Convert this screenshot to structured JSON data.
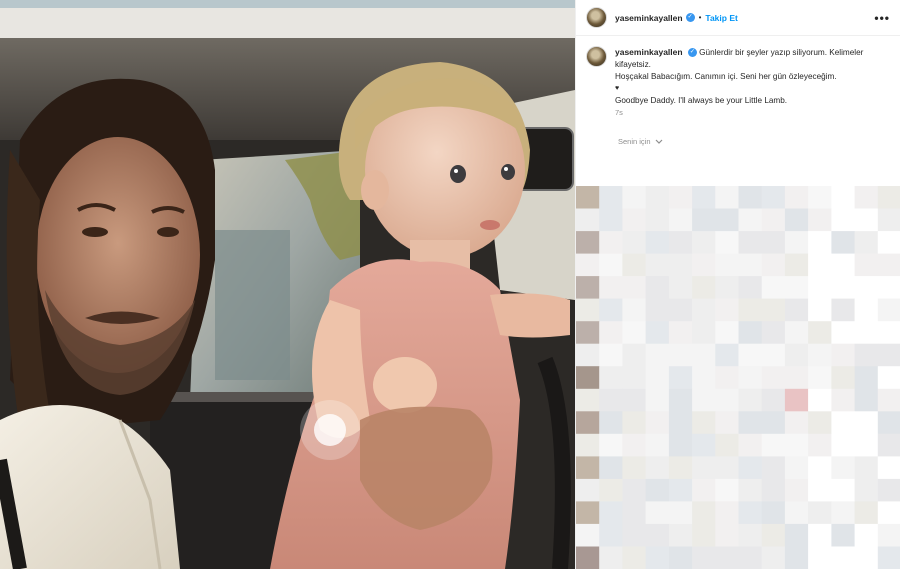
{
  "post": {
    "username": "yaseminkayallen",
    "verified_glyph": "✓",
    "dot": "•",
    "follow_label": "Takip Et",
    "more_label": "•••",
    "caption_line1": "Günlerdir bir şeyler yazıp siliyorum. Kelimeler kifayetsiz.",
    "caption_line2": "Hoşçakal Babacığım. Canımın içi. Seni her gün özleyeceğim.",
    "caption_heart": "♥",
    "caption_line3": "Goodbye Daddy. I'll always be your Little Lamb.",
    "timestamp": "7s",
    "for_you_label": "Senin için",
    "for_you_icon": "chevron-down-icon"
  },
  "colors": {
    "accent": "#0095f6",
    "verified": "#3897f0",
    "muted_text": "#8e8e8e"
  }
}
